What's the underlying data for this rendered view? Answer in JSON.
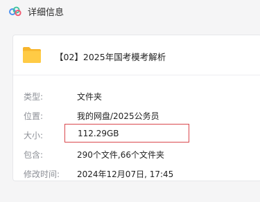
{
  "window": {
    "title": "详细信息",
    "logo_icon": "cloud-logo-icon"
  },
  "file": {
    "name": "【02】2025年国考模考解析",
    "icon": "folder-icon",
    "icon_color": "#ffc83d"
  },
  "details": [
    {
      "label": "类型:",
      "value": "文件夹"
    },
    {
      "label": "位置:",
      "value": "我的网盘/2025公务员"
    },
    {
      "label": "大小:",
      "value": "112.29GB",
      "highlight_color": "#d9474c"
    },
    {
      "label": "包含:",
      "value": "290个文件,66个文件夹"
    },
    {
      "label": "修改时间:",
      "value": "2024年12月07日, 17:45"
    }
  ]
}
